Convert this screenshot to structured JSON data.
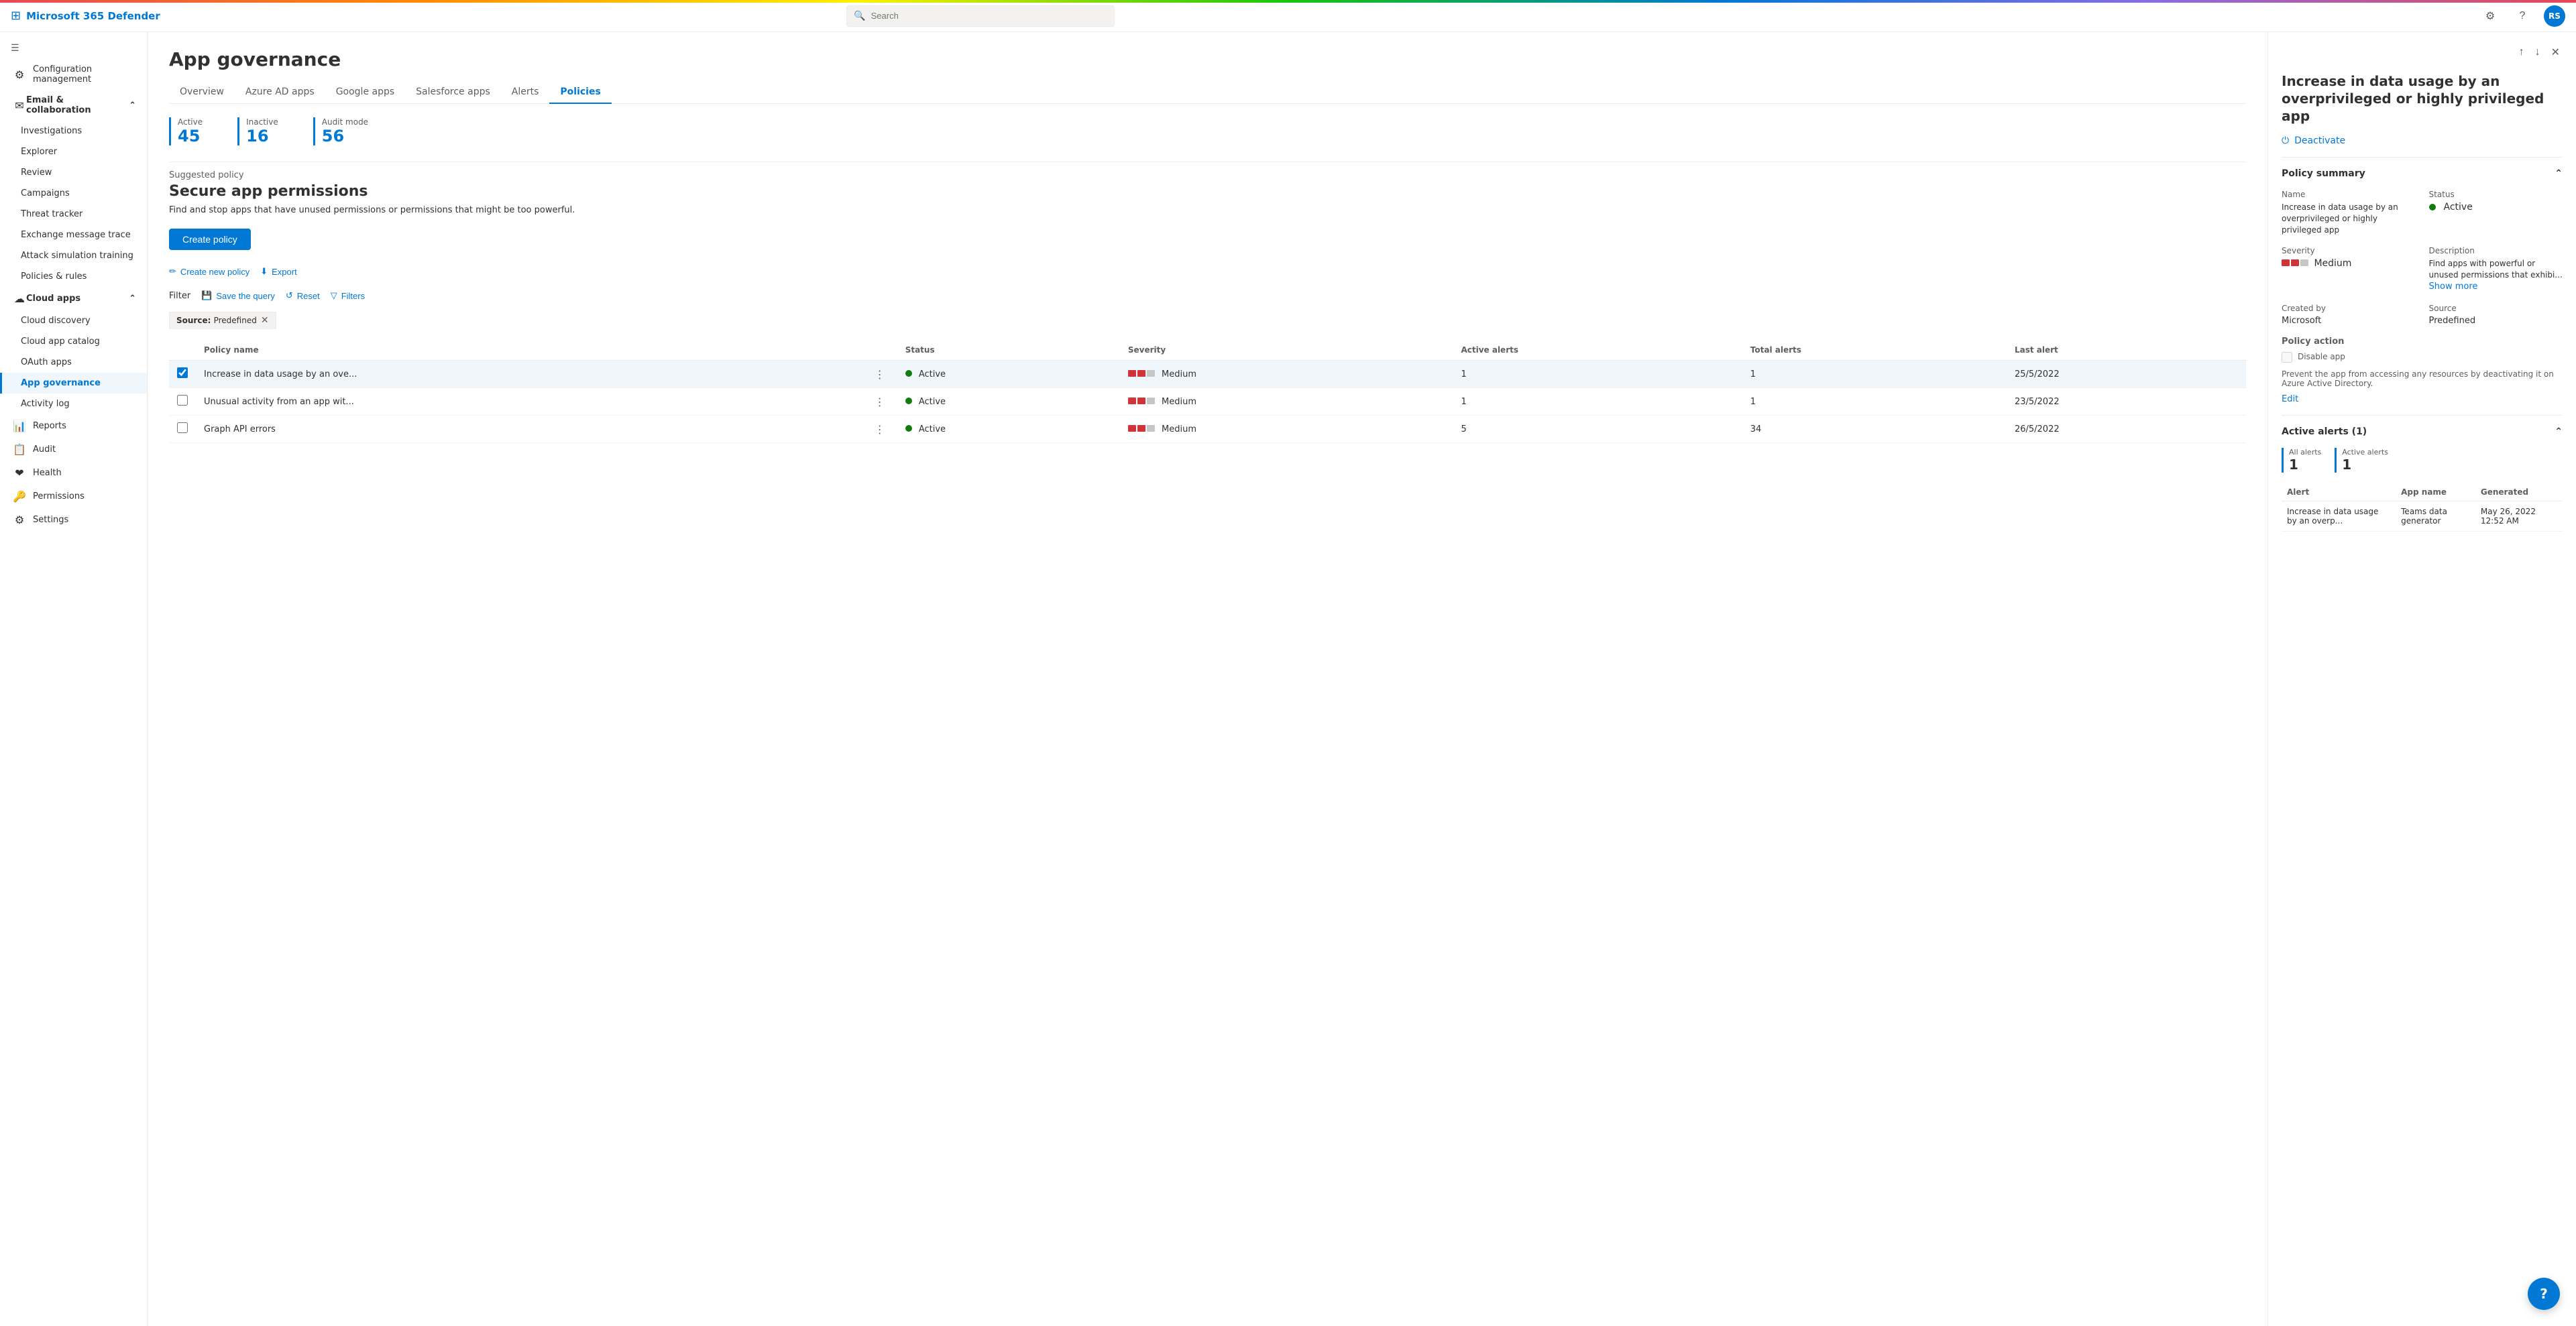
{
  "topbar": {
    "logo_icon": "⊞",
    "title": "Microsoft 365 Defender",
    "search_placeholder": "Search",
    "settings_icon": "⚙",
    "help_icon": "?",
    "avatar_initials": "RS"
  },
  "sidebar": {
    "hamburger_icon": "☰",
    "items": [
      {
        "id": "configuration-management",
        "label": "Configuration management",
        "icon": "⚙"
      },
      {
        "id": "email-collaboration",
        "label": "Email & collaboration",
        "icon": "✉",
        "expandable": true,
        "expanded": true
      },
      {
        "id": "investigations",
        "label": "Investigations",
        "icon": "🔍",
        "indent": true
      },
      {
        "id": "explorer",
        "label": "Explorer",
        "icon": "📊",
        "indent": true
      },
      {
        "id": "review",
        "label": "Review",
        "icon": "📋",
        "indent": true
      },
      {
        "id": "campaigns",
        "label": "Campaigns",
        "icon": "🎯",
        "indent": true
      },
      {
        "id": "threat-tracker",
        "label": "Threat tracker",
        "icon": "📈",
        "indent": true
      },
      {
        "id": "exchange-message-trace",
        "label": "Exchange message trace",
        "icon": "📨",
        "indent": true
      },
      {
        "id": "attack-simulation-training",
        "label": "Attack simulation training",
        "icon": "🛡",
        "indent": true
      },
      {
        "id": "policies-rules",
        "label": "Policies & rules",
        "icon": "📝",
        "indent": true
      },
      {
        "id": "cloud-apps",
        "label": "Cloud apps",
        "icon": "☁",
        "expandable": true,
        "expanded": true
      },
      {
        "id": "cloud-discovery",
        "label": "Cloud discovery",
        "icon": "🔭",
        "indent": true
      },
      {
        "id": "cloud-app-catalog",
        "label": "Cloud app catalog",
        "icon": "📚",
        "indent": true
      },
      {
        "id": "oauth-apps",
        "label": "OAuth apps",
        "icon": "🔐",
        "indent": true
      },
      {
        "id": "app-governance",
        "label": "App governance",
        "icon": "🛡",
        "indent": true,
        "active": true
      },
      {
        "id": "activity-log",
        "label": "Activity log",
        "icon": "📒",
        "indent": true
      },
      {
        "id": "reports",
        "label": "Reports",
        "icon": "📊"
      },
      {
        "id": "audit",
        "label": "Audit",
        "icon": "📋"
      },
      {
        "id": "health",
        "label": "Health",
        "icon": "❤"
      },
      {
        "id": "permissions",
        "label": "Permissions",
        "icon": "🔑"
      },
      {
        "id": "settings",
        "label": "Settings",
        "icon": "⚙"
      }
    ]
  },
  "main": {
    "page_title": "App governance",
    "tabs": [
      {
        "id": "overview",
        "label": "Overview",
        "active": false
      },
      {
        "id": "azure-ad-apps",
        "label": "Azure AD apps",
        "active": false
      },
      {
        "id": "google-apps",
        "label": "Google apps",
        "active": false
      },
      {
        "id": "salesforce-apps",
        "label": "Salesforce apps",
        "active": false
      },
      {
        "id": "alerts",
        "label": "Alerts",
        "active": false
      },
      {
        "id": "policies",
        "label": "Policies",
        "active": true
      }
    ],
    "stats": [
      {
        "label": "Active",
        "value": "45"
      },
      {
        "label": "Inactive",
        "value": "16"
      },
      {
        "label": "Audit mode",
        "value": "56"
      }
    ],
    "suggested_policy": {
      "label": "Suggested policy",
      "title": "Secure app permissions",
      "description": "Find and stop apps that have unused permissions or permissions that might be too powerful."
    },
    "create_policy_label": "Create policy",
    "toolbar": {
      "create_new_policy": "Create new policy",
      "export": "Export",
      "filter_label": "Filter",
      "save_the_query": "Save the query",
      "reset": "Reset",
      "filters": "Filters"
    },
    "active_filter": {
      "key": "Source",
      "value": "Predefined"
    },
    "table": {
      "columns": [
        "",
        "Policy name",
        "",
        "Status",
        "Severity",
        "Active alerts",
        "Total alerts",
        "Last alert"
      ],
      "rows": [
        {
          "selected": true,
          "checkbox": true,
          "name": "Increase in data usage by an ove...",
          "status": "Active",
          "severity": "Medium",
          "active_alerts": "1",
          "total_alerts": "1",
          "last_alert": "25/5/2022"
        },
        {
          "selected": false,
          "checkbox": false,
          "name": "Unusual activity from an app wit...",
          "status": "Active",
          "severity": "Medium",
          "active_alerts": "1",
          "total_alerts": "1",
          "last_alert": "23/5/2022"
        },
        {
          "selected": false,
          "checkbox": false,
          "name": "Graph API errors",
          "status": "Active",
          "severity": "Medium",
          "active_alerts": "5",
          "total_alerts": "34",
          "last_alert": "26/5/2022"
        }
      ]
    }
  },
  "right_panel": {
    "title": "Increase in data usage by an overprivileged or highly privileged app",
    "deactivate_label": "Deactivate",
    "policy_summary_label": "Policy summary",
    "name_label": "Name",
    "name_value": "Increase in data usage by an overprivileged or highly privileged app",
    "status_label": "Status",
    "status_value": "Active",
    "severity_label": "Severity",
    "severity_value": "Medium",
    "description_label": "Description",
    "description_value": "Find apps with powerful or unused permissions that exhibi...",
    "show_more": "Show more",
    "created_by_label": "Created by",
    "created_by_value": "Microsoft",
    "source_label": "Source",
    "source_value": "Predefined",
    "policy_action_label": "Policy action",
    "disable_app_label": "Disable app",
    "policy_action_desc": "Prevent the app from accessing any resources by deactivating it on Azure Active Directory.",
    "edit_label": "Edit",
    "active_alerts_label": "Active alerts (1)",
    "all_alerts_label": "All alerts",
    "all_alerts_value": "1",
    "active_alerts_count_label": "Active alerts",
    "active_alerts_count_value": "1",
    "alerts_table": {
      "columns": [
        "Alert",
        "App name",
        "Generated"
      ],
      "rows": [
        {
          "alert": "Increase in data usage by an overp...",
          "app_name": "Teams data generator",
          "generated": "May 26, 2022 12:52 AM"
        }
      ]
    }
  },
  "help_button": "?"
}
